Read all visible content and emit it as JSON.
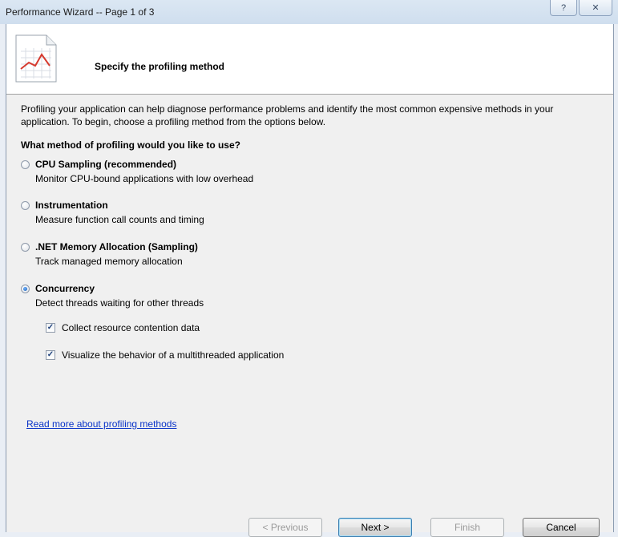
{
  "window": {
    "title": "Performance Wizard -- Page 1 of 3",
    "help_glyph": "?",
    "close_glyph": "✕"
  },
  "header": {
    "title": "Specify the profiling method",
    "icon": "performance-chart-icon"
  },
  "intro": "Profiling your application can help diagnose performance problems and identify the most common expensive methods in your application. To begin, choose a profiling method from the options below.",
  "question": "What method of profiling would you like to use?",
  "options": [
    {
      "label": "CPU Sampling (recommended)",
      "description": "Monitor CPU-bound applications with low overhead",
      "selected": false
    },
    {
      "label": "Instrumentation",
      "description": "Measure function call counts and timing",
      "selected": false
    },
    {
      "label": ".NET Memory Allocation (Sampling)",
      "description": "Track managed memory allocation",
      "selected": false
    },
    {
      "label": "Concurrency",
      "description": "Detect threads waiting for other threads",
      "selected": true
    }
  ],
  "concurrency_options": [
    {
      "label": "Collect resource contention data",
      "checked": true
    },
    {
      "label": "Visualize the behavior of a multithreaded application",
      "checked": true
    }
  ],
  "link": "Read more about profiling methods",
  "buttons": {
    "previous": "< Previous",
    "next": "Next >",
    "finish": "Finish",
    "cancel": "Cancel"
  },
  "check_glyph": "✓"
}
